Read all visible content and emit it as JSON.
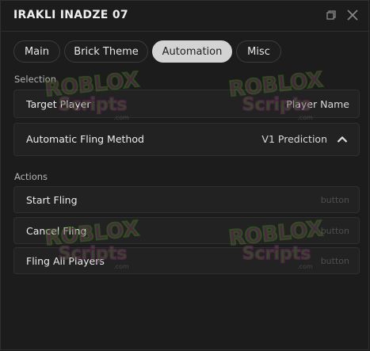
{
  "window": {
    "title": "IRAKLI INADZE 07"
  },
  "tabs": [
    {
      "label": "Main",
      "active": false
    },
    {
      "label": "Brick Theme",
      "active": false
    },
    {
      "label": "Automation",
      "active": true
    },
    {
      "label": "Misc",
      "active": false
    }
  ],
  "sections": {
    "selection": "Selection",
    "actions": "Actions"
  },
  "selection_rows": {
    "target": {
      "label": "Target Player",
      "value": "Player Name"
    },
    "method": {
      "label": "Automatic Fling Method",
      "value": "V1 Prediction"
    }
  },
  "action_rows": [
    {
      "label": "Start Fling",
      "hint": "button"
    },
    {
      "label": "Cancel Fling",
      "hint": "button"
    },
    {
      "label": "Fling All Players",
      "hint": "button"
    }
  ],
  "watermark": {
    "line1": "ROBLOX",
    "line2": "Scripts",
    "line3": ".com"
  },
  "colors": {
    "background": "#1c1c1c",
    "row": "#222222",
    "active_tab": "#d3d3d3",
    "watermark_green": "#3f7a1f",
    "watermark_purple": "#7a2a6a"
  }
}
